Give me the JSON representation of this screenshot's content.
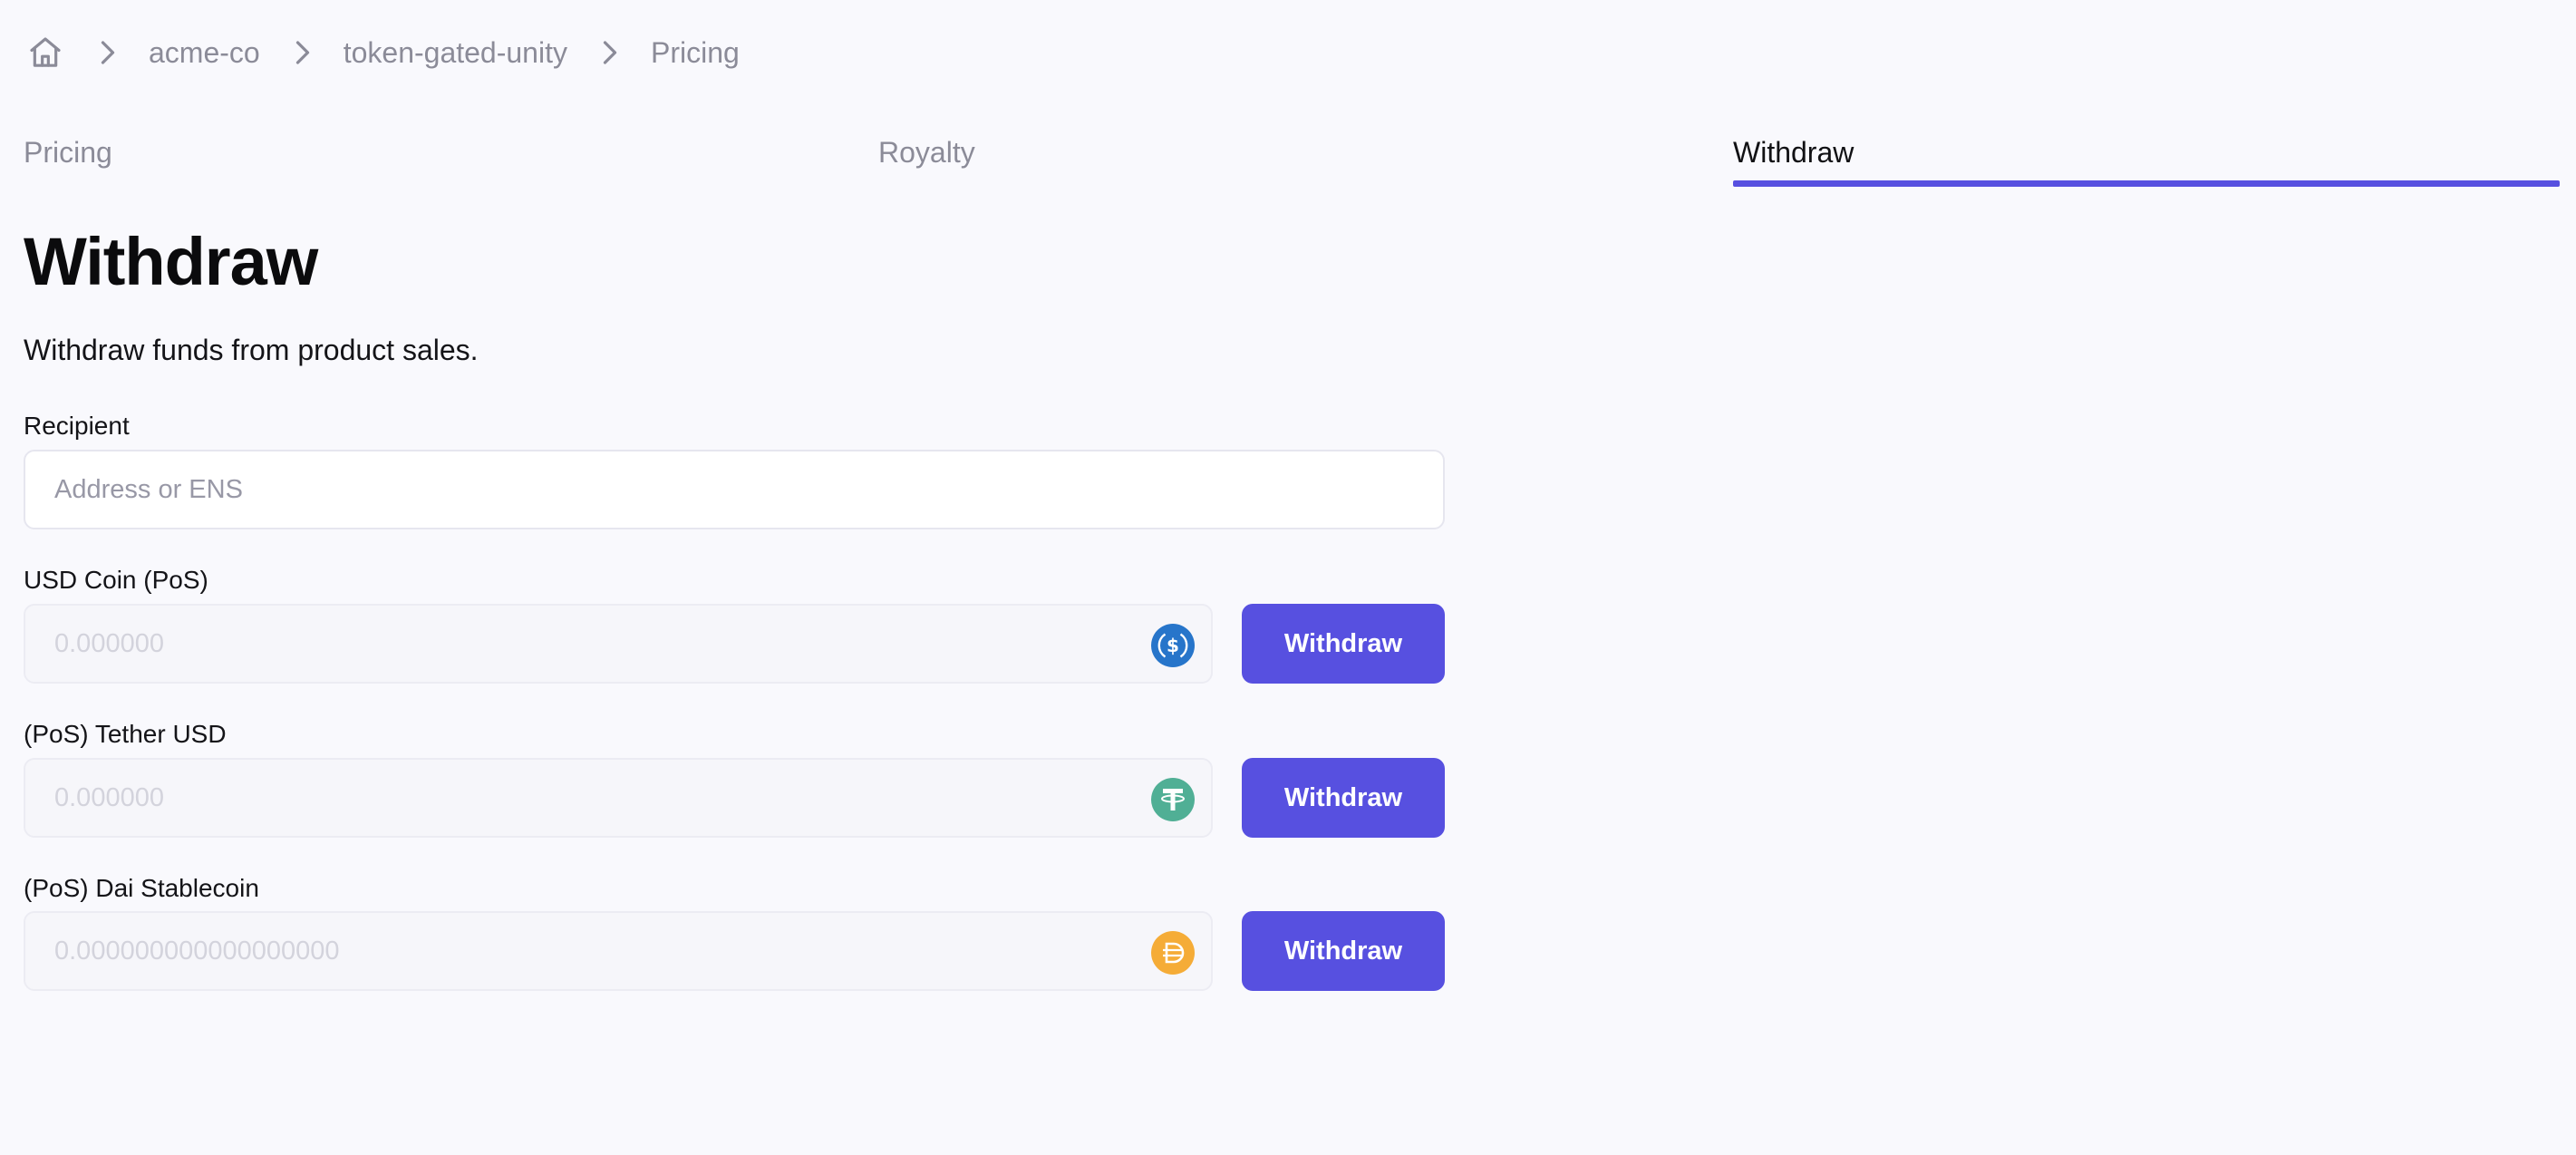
{
  "breadcrumb": {
    "home_icon": "home-icon",
    "separator_icon": "chevron-right-icon",
    "items": [
      {
        "label": "acme-co"
      },
      {
        "label": "token-gated-unity"
      },
      {
        "label": "Pricing"
      }
    ]
  },
  "tabs": [
    {
      "label": "Pricing",
      "active": false
    },
    {
      "label": "Royalty",
      "active": false
    },
    {
      "label": "Withdraw",
      "active": true
    }
  ],
  "accent_color": "#5750e0",
  "page": {
    "title": "Withdraw",
    "subtitle": "Withdraw funds from product sales."
  },
  "recipient": {
    "label": "Recipient",
    "placeholder": "Address or ENS",
    "value": ""
  },
  "tokens": [
    {
      "label": "USD Coin (PoS)",
      "placeholder": "0.000000",
      "icon": "usdc-icon",
      "icon_color": "#2775ca",
      "button": "Withdraw"
    },
    {
      "label": "(PoS) Tether USD",
      "placeholder": "0.000000",
      "icon": "tether-icon",
      "icon_color": "#50af95",
      "button": "Withdraw"
    },
    {
      "label": "(PoS) Dai Stablecoin",
      "placeholder": "0.000000000000000000",
      "icon": "dai-icon",
      "icon_color": "#f5ac37",
      "button": "Withdraw"
    }
  ]
}
